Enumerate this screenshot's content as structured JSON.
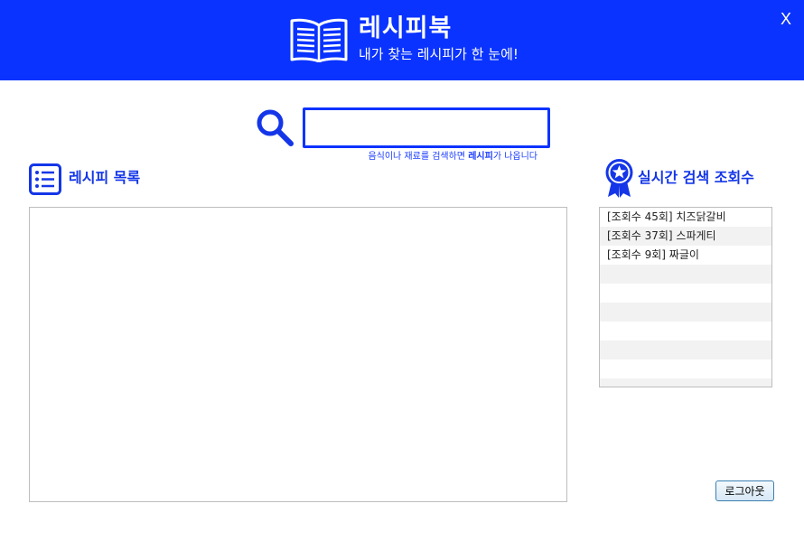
{
  "header": {
    "title": "레시피북",
    "subtitle": "내가 찾는 레시피가 한 눈에!",
    "close_label": "X",
    "bg_color": "#0a33ff",
    "icon": "open-book-icon"
  },
  "search": {
    "value": "",
    "placeholder": "",
    "hint_pre": "음식이나 재료를 검색하면 ",
    "hint_bold": "레시피",
    "hint_post": "가 나옵니다",
    "icon": "magnifier-icon"
  },
  "recipe_list": {
    "title": "레시피 목록",
    "icon": "list-icon",
    "items": []
  },
  "ranking": {
    "title": "실시간 검색 조회수",
    "icon": "award-ribbon-icon",
    "rows": [
      "[조회수 45회] 치즈닭갈비",
      "[조회수 37회] 스파게티",
      "[조회수 9회] 짜글이",
      "",
      "",
      "",
      "",
      "",
      "",
      ""
    ]
  },
  "logout_label": "로그아웃",
  "accent_color": "#1436e8"
}
